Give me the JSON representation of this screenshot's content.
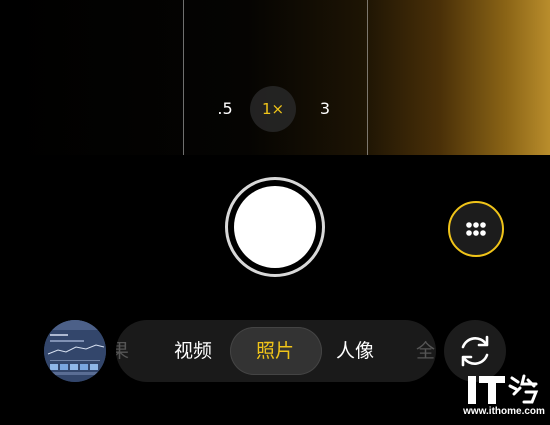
{
  "zoom": {
    "options": [
      ".5",
      "1×",
      "3"
    ],
    "selected": "1×"
  },
  "modes": {
    "items": [
      "果",
      "视频",
      "照片",
      "人像",
      "全"
    ],
    "selected": "照片"
  },
  "controls": {
    "shutter": "shutter",
    "more": "more-options",
    "switch_camera": "switch-camera",
    "gallery": "gallery-thumbnail"
  },
  "watermark": {
    "logo_text": "IT之家",
    "url": "www.ithome.com"
  },
  "colors": {
    "accent": "#f0c419",
    "background": "#000000",
    "pill": "#1a1a1a",
    "active_pill": "#333333"
  },
  "icons": [
    "grid-dots-icon",
    "camera-switch-icon"
  ]
}
